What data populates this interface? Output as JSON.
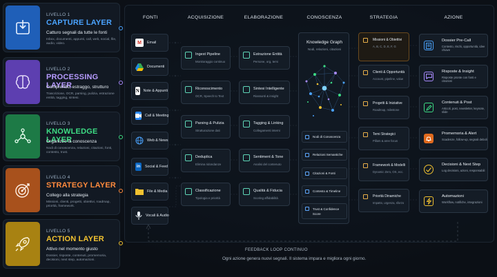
{
  "layers": [
    {
      "num": "LIVELLO 1",
      "name": "CAPTURE LAYER",
      "sub": "Catturo segnali da tutte le fonti",
      "desc": "Inbox, documenti, appunti, call, web, social, file, audio, video.",
      "color": "#4aa3ff"
    },
    {
      "num": "LIVELLO 2",
      "name": "PROCESSING LAYER",
      "sub": "Comprendo, estraggo, strutturo",
      "desc": "Trascrizione, OCR, parsing, pulizia, estrazione entità, tagging, sintesi.",
      "color": "#a98bff"
    },
    {
      "num": "LIVELLO 3",
      "name": "KNOWLEDGE LAYER",
      "sub": "Organizzo la conoscenza",
      "desc": "Nodi di conoscenza, relazioni, citazioni, fonti, contesto, trust.",
      "color": "#3ddc84"
    },
    {
      "num": "LIVELLO 4",
      "name": "STRATEGY LAYER",
      "sub": "Collego alla strategia",
      "desc": "Missioni, clienti, progetti, obiettivi, roadmap, priorità, framework.",
      "color": "#ff8a3d"
    },
    {
      "num": "LIVELLO 5",
      "name": "ACTION LAYER",
      "sub": "Attivo nel momento giusto",
      "desc": "Dossier, risposte, contenuti, promemoria, decisioni, next step, automazioni.",
      "color": "#f2c230"
    }
  ],
  "columns": [
    "FONTI",
    "ACQUISIZIONE",
    "ELABORAZIONE",
    "CONOSCENZA",
    "STRATEGIA",
    "AZIONE"
  ],
  "fonti": [
    "Email",
    "Documenti",
    "Note & Appunti",
    "Call & Meeting",
    "Web & News",
    "Social & Feed",
    "File & Media",
    "Vocali & Audio"
  ],
  "acquisizione": [
    {
      "t": "Ingest Pipeline",
      "s": "Monitoraggio continuo"
    },
    {
      "t": "Riconoscimento",
      "s": "OCR, Speech to Text"
    },
    {
      "t": "Parsing & Pulizia",
      "s": "Strutturazione dati"
    },
    {
      "t": "Deduplica",
      "s": "Elimina ridondanze"
    },
    {
      "t": "Classificazione",
      "s": "Tipologia e priorità"
    }
  ],
  "elaborazione": [
    {
      "t": "Estrazione Entità",
      "s": "Persone, org, temi"
    },
    {
      "t": "Sintesi Intelligente",
      "s": "Riassunti & insight"
    },
    {
      "t": "Tagging & Linking",
      "s": "Collegamenti interni"
    },
    {
      "t": "Sentiment & Tone",
      "s": "Analisi del contenuto"
    },
    {
      "t": "Qualità & Fiducia",
      "s": "Scoring affidabilità"
    }
  ],
  "graph": {
    "title": "Knowledge Graph",
    "sub": "Nodi, relazioni, citazioni"
  },
  "conoscenza": [
    "Nodi di Conoscenza",
    "Relazioni Semantiche",
    "Citazioni & Fonti",
    "Contesto & Timeline",
    "Trust & Confidence Score"
  ],
  "strategia": [
    {
      "t": "Missioni & Obiettivi",
      "s": "A, B, C, D, E, F, G"
    },
    {
      "t": "Clienti & Opportunità",
      "s": "Account, pipeline, value"
    },
    {
      "t": "Progetti & Iniziative",
      "s": "Roadmap, milestone"
    },
    {
      "t": "Temi Strategici",
      "s": "Pillars & aree focus"
    },
    {
      "t": "Framework & Modelli",
      "s": "Dynamic Zero, OS, ecc."
    },
    {
      "t": "Priorità Dinamiche",
      "s": "Impatto, urgenza, sforzo"
    }
  ],
  "azione": [
    {
      "t": "Dossier Pre-Call",
      "s": "Contesto, rischi, opportunità, idee chiave"
    },
    {
      "t": "Risposte & Insight",
      "s": "Risposte pronte con fonti e citazioni"
    },
    {
      "t": "Contenuti & Post",
      "s": "Articoli, post, newsletter, keynote, slide"
    },
    {
      "t": "Promemoria & Alert",
      "s": "Scadenze, follow-up, segnali deboli"
    },
    {
      "t": "Decisioni & Next Step",
      "s": "Log decisioni, azioni, responsabili"
    },
    {
      "t": "Automazioni",
      "s": "Workflow, notifiche, integrazioni"
    }
  ],
  "feedback": {
    "title": "FEEDBACK LOOP CONTINUO",
    "sub": "Ogni azione genera nuovi segnali. Il sistema impara e migliora ogni giorno."
  }
}
